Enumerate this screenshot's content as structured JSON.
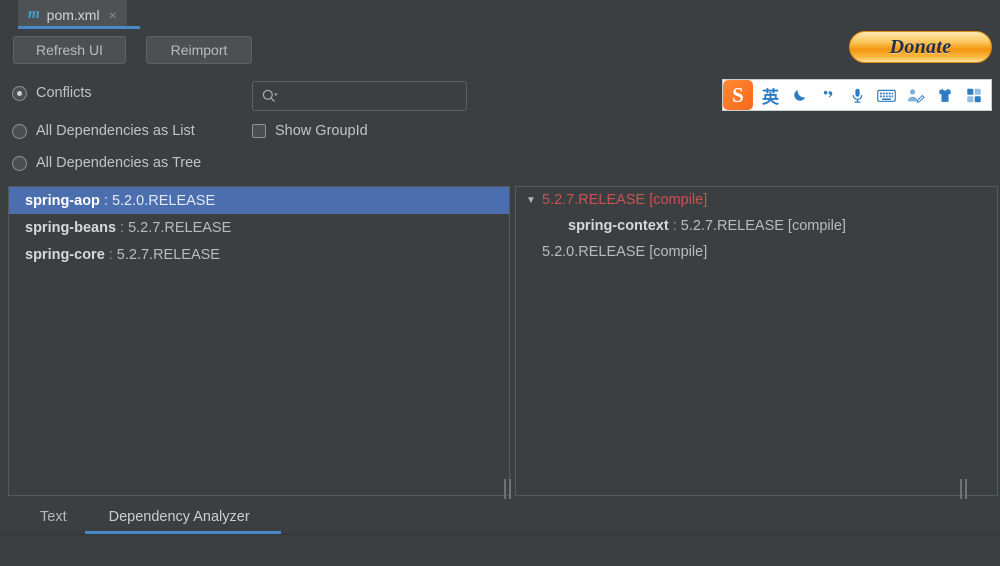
{
  "window": {
    "tab": {
      "icon": "maven-m-icon",
      "label": "pom.xml",
      "close": "×"
    }
  },
  "toolbar": {
    "refresh_label": "Refresh UI",
    "reimport_label": "Reimport",
    "donate_label": "Donate"
  },
  "ime": {
    "logo": "S",
    "items": [
      {
        "name": "language-mode-english",
        "glyph": "英"
      },
      {
        "name": "moon-icon",
        "glyph": "moon"
      },
      {
        "name": "punctuation-icon",
        "glyph": "punct"
      },
      {
        "name": "microphone-icon",
        "glyph": "mic"
      },
      {
        "name": "soft-keyboard-icon",
        "glyph": "keyboard"
      },
      {
        "name": "handwriting-icon",
        "glyph": "handwrite"
      },
      {
        "name": "skin-icon",
        "glyph": "shirt"
      },
      {
        "name": "toolbox-icon",
        "glyph": "grid"
      }
    ]
  },
  "options": {
    "conflicts": {
      "label": "Conflicts",
      "checked": true
    },
    "all_as_list": {
      "label": "All Dependencies as List",
      "checked": false
    },
    "all_as_tree": {
      "label": "All Dependencies as Tree",
      "checked": false
    },
    "show_groupid": {
      "label": "Show GroupId",
      "checked": false
    }
  },
  "search": {
    "value": "",
    "placeholder": ""
  },
  "list_pane": {
    "rows": [
      {
        "artifact": "spring-aop",
        "sep": ":",
        "version": "5.2.0.RELEASE",
        "selected": true
      },
      {
        "artifact": "spring-beans",
        "sep": ":",
        "version": "5.2.7.RELEASE",
        "selected": false
      },
      {
        "artifact": "spring-core",
        "sep": ":",
        "version": "5.2.7.RELEASE",
        "selected": false
      }
    ]
  },
  "tree_pane": {
    "rows": [
      {
        "toggle": "▼",
        "indent": 0,
        "artifact": "",
        "sep": "",
        "text": "5.2.7.RELEASE [compile]",
        "red": true
      },
      {
        "toggle": "",
        "indent": 2,
        "artifact": "spring-context",
        "sep": ":",
        "text": "5.2.7.RELEASE [compile]",
        "red": false
      },
      {
        "toggle": "",
        "indent": 1,
        "artifact": "",
        "sep": "",
        "text": "5.2.0.RELEASE [compile]",
        "red": false
      }
    ]
  },
  "bottom_tabs": {
    "text_label": "Text",
    "dependency_label": "Dependency Analyzer",
    "active": "Dependency Analyzer"
  },
  "colors": {
    "background": "#3c3f41",
    "selection": "#4b6eaf",
    "accent": "#4a88c7",
    "conflict_red": "#c75450",
    "donate_orange": "#f3960f",
    "ime_blue": "#2d7dc4"
  }
}
